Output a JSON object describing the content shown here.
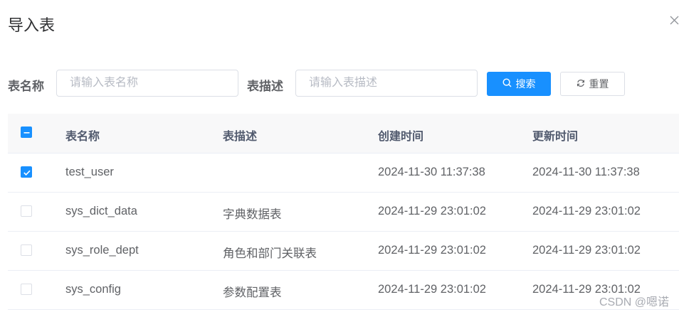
{
  "dialog": {
    "title": "导入表"
  },
  "search": {
    "table_name_label": "表名称",
    "table_name_placeholder": "请输入表名称",
    "table_desc_label": "表描述",
    "table_desc_placeholder": "请输入表描述",
    "search_label": "搜索",
    "reset_label": "重置"
  },
  "table": {
    "columns": [
      "表名称",
      "表描述",
      "创建时间",
      "更新时间"
    ],
    "rows": [
      {
        "checked": true,
        "name": "test_user",
        "desc": "",
        "created": "2024-11-30 11:37:38",
        "updated": "2024-11-30 11:37:38"
      },
      {
        "checked": false,
        "name": "sys_dict_data",
        "desc": "字典数据表",
        "created": "2024-11-29 23:01:02",
        "updated": "2024-11-29 23:01:02"
      },
      {
        "checked": false,
        "name": "sys_role_dept",
        "desc": "角色和部门关联表",
        "created": "2024-11-29 23:01:02",
        "updated": "2024-11-29 23:01:02"
      },
      {
        "checked": false,
        "name": "sys_config",
        "desc": "参数配置表",
        "created": "2024-11-29 23:01:02",
        "updated": "2024-11-29 23:01:02"
      }
    ]
  },
  "watermark": "CSDN @嗯诺",
  "colors": {
    "primary": "#1890ff",
    "header_bg": "#f8f8f9",
    "border": "#ebeef5"
  }
}
